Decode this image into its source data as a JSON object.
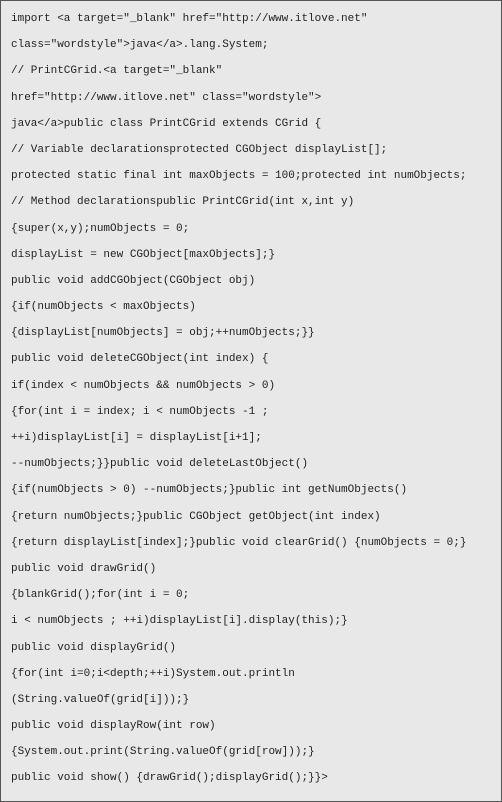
{
  "code": {
    "lines": [
      "import <a target=\"_blank\" href=\"http://www.itlove.net\"",
      "class=\"wordstyle\">java</a>.lang.System;",
      "// PrintCGrid.<a target=\"_blank\"",
      "href=\"http://www.itlove.net\" class=\"wordstyle\">",
      "java</a>public class PrintCGrid extends CGrid {",
      "// Variable declarationsprotected CGObject displayList[];",
      "protected static final int maxObjects = 100;protected int numObjects;",
      "// Method declarationspublic PrintCGrid(int x,int y)",
      "{super(x,y);numObjects = 0;",
      "displayList = new CGObject[maxObjects];}",
      "public void addCGObject(CGObject obj)",
      "{if(numObjects < maxObjects)",
      "{displayList[numObjects] = obj;++numObjects;}}",
      "public void deleteCGObject(int index) {",
      "if(index < numObjects && numObjects > 0)",
      "{for(int i = index; i < numObjects -1 ;",
      "++i)displayList[i] = displayList[i+1];",
      "--numObjects;}}public void deleteLastObject()",
      "{if(numObjects > 0) --numObjects;}public int getNumObjects()",
      "{return numObjects;}public CGObject getObject(int index)",
      "{return displayList[index];}public void clearGrid() {numObjects = 0;}",
      "public void drawGrid()",
      "{blankGrid();for(int i = 0;",
      "i < numObjects ; ++i)displayList[i].display(this);}",
      "public void displayGrid()",
      "{for(int i=0;i<depth;++i)System.out.println",
      "(String.valueOf(grid[i]));}",
      "public void displayRow(int row)",
      "{System.out.print(String.valueOf(grid[row]));}",
      "public void show() {drawGrid();displayGrid();}}>"
    ]
  }
}
